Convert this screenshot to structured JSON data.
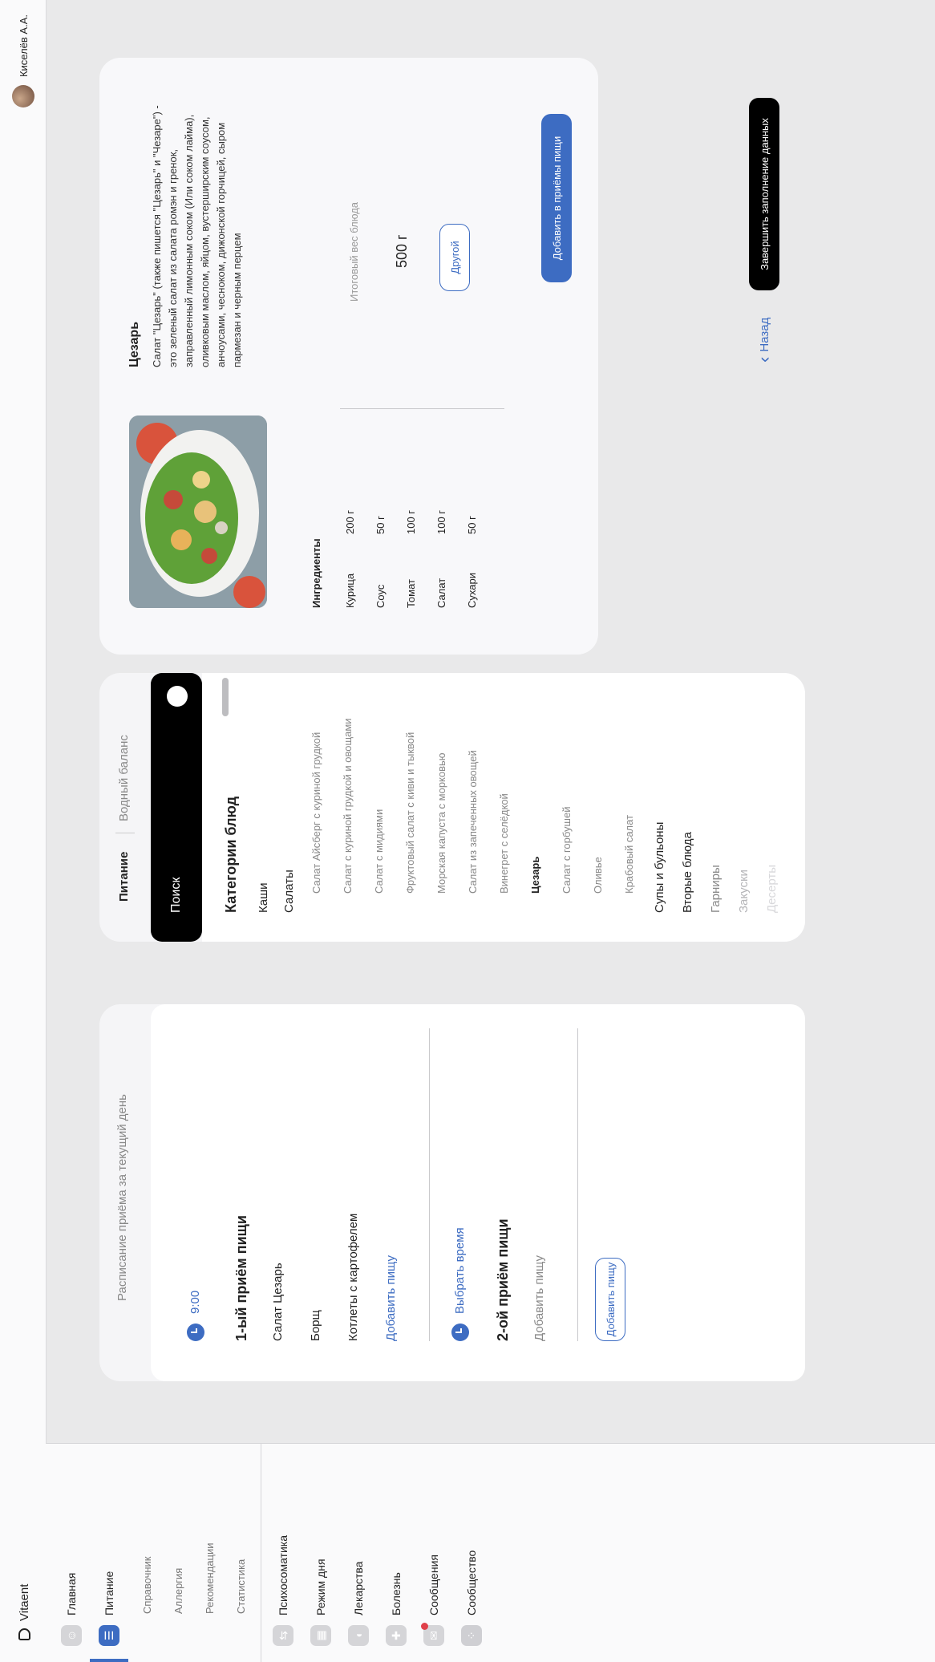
{
  "app": {
    "name": "Vitaent"
  },
  "user": {
    "name": "Киселёв А.А."
  },
  "sidebar": {
    "main": "Главная",
    "nutrition": "Питание",
    "sub": [
      "Справочник",
      "Аллергия",
      "Рекомендации",
      "Статистика"
    ],
    "items": [
      "Психосоматика",
      "Режим дня",
      "Лекарства",
      "Болезнь",
      "Сообщения",
      "Сообщество"
    ]
  },
  "schedule": {
    "title": "Расписание приёма за текущий день",
    "meal1": {
      "time": "9:00",
      "title": "1-ый приём пищи",
      "items": [
        "Салат Цезарь",
        "Борщ",
        "Котлеты с картофелем"
      ],
      "add": "Добавить пищу"
    },
    "choose_time": "Выбрать время",
    "meal2": {
      "title": "2-ой приём пищи",
      "placeholder": "Добавить пищу",
      "add_button": "Добавить пищу"
    }
  },
  "tabs": {
    "nutrition": "Питание",
    "water": "Водный баланс"
  },
  "search": {
    "label": "Поиск"
  },
  "categories": {
    "title": "Категории блюд",
    "porridge": "Каши",
    "salads": "Салаты",
    "salad_items": [
      "Салат Айсберг с куриной грудкой",
      "Салат с куриной грудкой и овощами",
      "Салат с мидиями",
      "Фруктовый салат с киви и тыквой",
      "Морская капуста с морковью",
      "Салат из запеченных овощей",
      "Винегрет с селёдкой",
      "Цезарь",
      "Салат с горбушей",
      "Оливье",
      "Крабовый салат"
    ],
    "more": [
      "Супы и бульоны",
      "Вторые блюда",
      "Гарниры",
      "Закуски",
      "Десерты"
    ]
  },
  "dish": {
    "name": "Цезарь",
    "description": "Салат \"Цезарь\" (также пишется \"Цезарь\" и \"Чезаре\") - это зеленый салат из салата ромэн и гренок, заправленный лимонным соком (Или соком лайма), оливковым маслом, яйцом, вустерширским соусом, анчоусами, чесноком, дижонской горчицей, сыром пармезан и черным перцем",
    "ingredients_title": "Ингредиенты",
    "ingredients": [
      {
        "name": "Курица",
        "weight": "200 г"
      },
      {
        "name": "Соус",
        "weight": "50 г"
      },
      {
        "name": "Томат",
        "weight": "100 г"
      },
      {
        "name": "Салат",
        "weight": "100 г"
      },
      {
        "name": "Сухари",
        "weight": "50 г"
      }
    ],
    "total_label": "Итоговый вес блюда",
    "total_value": "500 г",
    "other": "Другой",
    "add_button": "Добавить в приёмы пищи"
  },
  "back": "Назад",
  "finish": "Завершить заполнение данных",
  "colors": {
    "accent": "#3d6cc2",
    "notification": "#e0404a"
  }
}
